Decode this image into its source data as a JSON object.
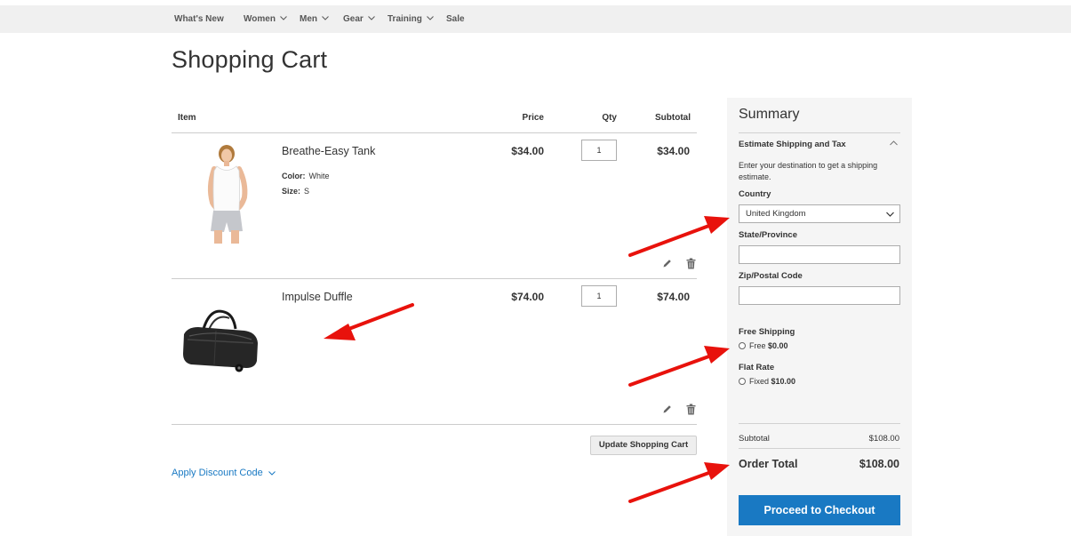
{
  "nav": {
    "items": [
      {
        "label": "What's New"
      },
      {
        "label": "Women"
      },
      {
        "label": "Men"
      },
      {
        "label": "Gear"
      },
      {
        "label": "Training"
      },
      {
        "label": "Sale"
      }
    ]
  },
  "page_title": "Shopping Cart",
  "cart": {
    "headers": {
      "item": "Item",
      "price": "Price",
      "qty": "Qty",
      "subtotal": "Subtotal"
    },
    "items": [
      {
        "name": "Breathe-Easy Tank",
        "options": [
          {
            "label": "Color:",
            "value": "White"
          },
          {
            "label": "Size:",
            "value": "S"
          }
        ],
        "price": "$34.00",
        "qty": "1",
        "subtotal": "$34.00"
      },
      {
        "name": "Impulse Duffle",
        "price": "$74.00",
        "qty": "1",
        "subtotal": "$74.00"
      }
    ],
    "update_label": "Update Shopping Cart",
    "discount_label": "Apply Discount Code"
  },
  "summary": {
    "title": "Summary",
    "estimate_title": "Estimate Shipping and Tax",
    "estimate_note": "Enter your destination to get a shipping estimate.",
    "country_label": "Country",
    "country_value": "United Kingdom",
    "state_label": "State/Province",
    "state_value": "",
    "zip_label": "Zip/Postal Code",
    "zip_value": "",
    "shipping": [
      {
        "title": "Free Shipping",
        "method": "Free",
        "price": "$0.00"
      },
      {
        "title": "Flat Rate",
        "method": "Fixed",
        "price": "$10.00"
      }
    ],
    "subtotal_label": "Subtotal",
    "subtotal_value": "$108.00",
    "total_label": "Order Total",
    "total_value": "$108.00",
    "checkout_label": "Proceed to Checkout"
  },
  "colors": {
    "accent": "#1979c3",
    "annotation": "#e8120c",
    "nav_bg": "#f0f0f0",
    "summary_bg": "#f5f5f5"
  }
}
